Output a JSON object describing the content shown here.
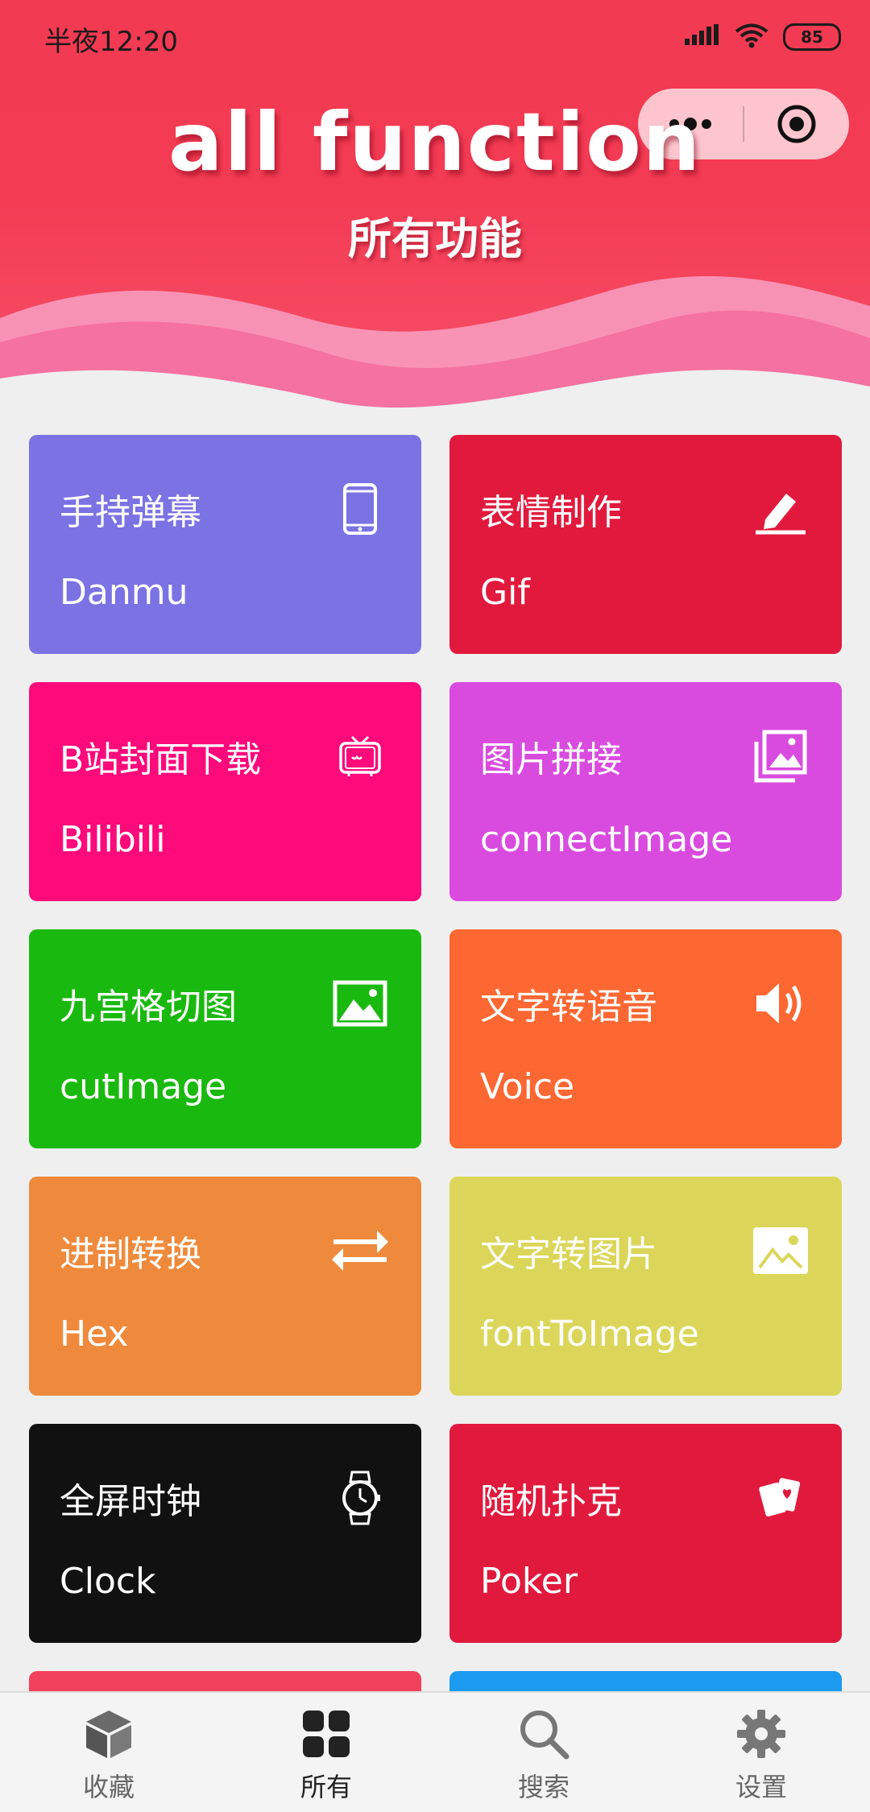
{
  "status_bar": {
    "time": "半夜12:20",
    "battery": "85"
  },
  "header": {
    "title": "all function",
    "subtitle": "所有功能"
  },
  "cards": [
    {
      "title": "手持弹幕",
      "subtitle": "Danmu",
      "color": "#7b72e4",
      "icon": "phone-icon"
    },
    {
      "title": "表情制作",
      "subtitle": "Gif",
      "color": "#e11a3d",
      "icon": "edit-icon"
    },
    {
      "title": "B站封面下载",
      "subtitle": "Bilibili",
      "color": "#fd0a7b",
      "icon": "tv-icon"
    },
    {
      "title": "图片拼接",
      "subtitle": "connectImage",
      "color": "#d94bdf",
      "icon": "images-icon"
    },
    {
      "title": "九宫格切图",
      "subtitle": "cutImage",
      "color": "#1ab90f",
      "icon": "image-icon"
    },
    {
      "title": "文字转语音",
      "subtitle": "Voice",
      "color": "#fd6732",
      "icon": "speaker-icon"
    },
    {
      "title": "进制转换",
      "subtitle": "Hex",
      "color": "#ef8a3c",
      "icon": "swap-icon"
    },
    {
      "title": "文字转图片",
      "subtitle": "fontToImage",
      "color": "#dbd659",
      "icon": "picture-icon"
    },
    {
      "title": "全屏时钟",
      "subtitle": "Clock",
      "color": "#111111",
      "icon": "watch-icon"
    },
    {
      "title": "随机扑克",
      "subtitle": "Poker",
      "color": "#e11a3d",
      "icon": "cards-icon"
    },
    {
      "title": "",
      "subtitle": "",
      "color": "#f2425b",
      "icon": ""
    },
    {
      "title": "",
      "subtitle": "",
      "color": "#1b9af0",
      "icon": ""
    }
  ],
  "tabbar": [
    {
      "label": "收藏",
      "icon": "cube-icon",
      "active": false
    },
    {
      "label": "所有",
      "icon": "grid-icon",
      "active": true
    },
    {
      "label": "搜索",
      "icon": "search-icon",
      "active": false
    },
    {
      "label": "设置",
      "icon": "gear-icon",
      "active": false
    }
  ]
}
